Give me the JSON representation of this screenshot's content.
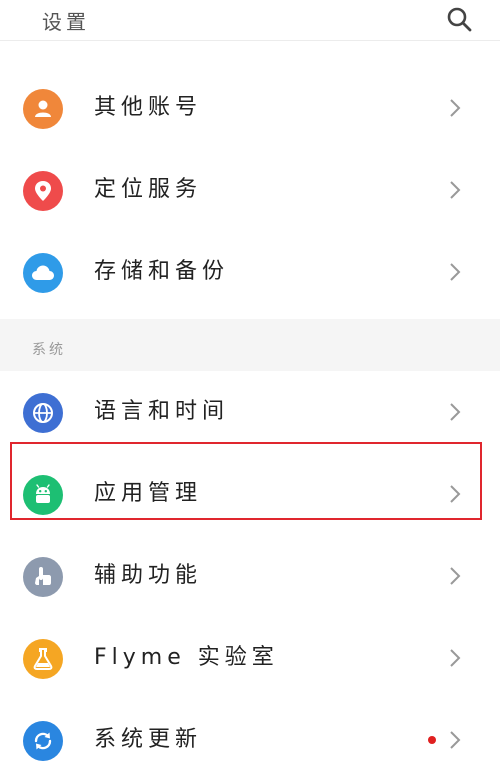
{
  "header": {
    "title": "设置",
    "search_icon": "search-icon"
  },
  "group1": [
    {
      "label": "其他账号",
      "icon": "person-icon",
      "color": "#f0873a"
    },
    {
      "label": "定位服务",
      "icon": "location-pin-icon",
      "color": "#ef4b4b"
    },
    {
      "label": "存储和备份",
      "icon": "cloud-icon",
      "color": "#2f9be8"
    }
  ],
  "section": {
    "title": "系统"
  },
  "group2": [
    {
      "label": "语言和时间",
      "icon": "globe-icon",
      "color": "#3e6fd3"
    },
    {
      "label": "应用管理",
      "icon": "android-icon",
      "color": "#1dbf73",
      "highlighted": true
    },
    {
      "label": "辅助功能",
      "icon": "hand-pointer-icon",
      "color": "#8d9aae"
    },
    {
      "label": "Flyme 实验室",
      "icon": "flask-icon",
      "color": "#f5a623"
    },
    {
      "label": "系统更新",
      "icon": "refresh-icon",
      "color": "#2a86e0",
      "badge_dot": true
    }
  ],
  "colors": {
    "highlight_border": "#e0262e",
    "badge": "#e02020"
  }
}
